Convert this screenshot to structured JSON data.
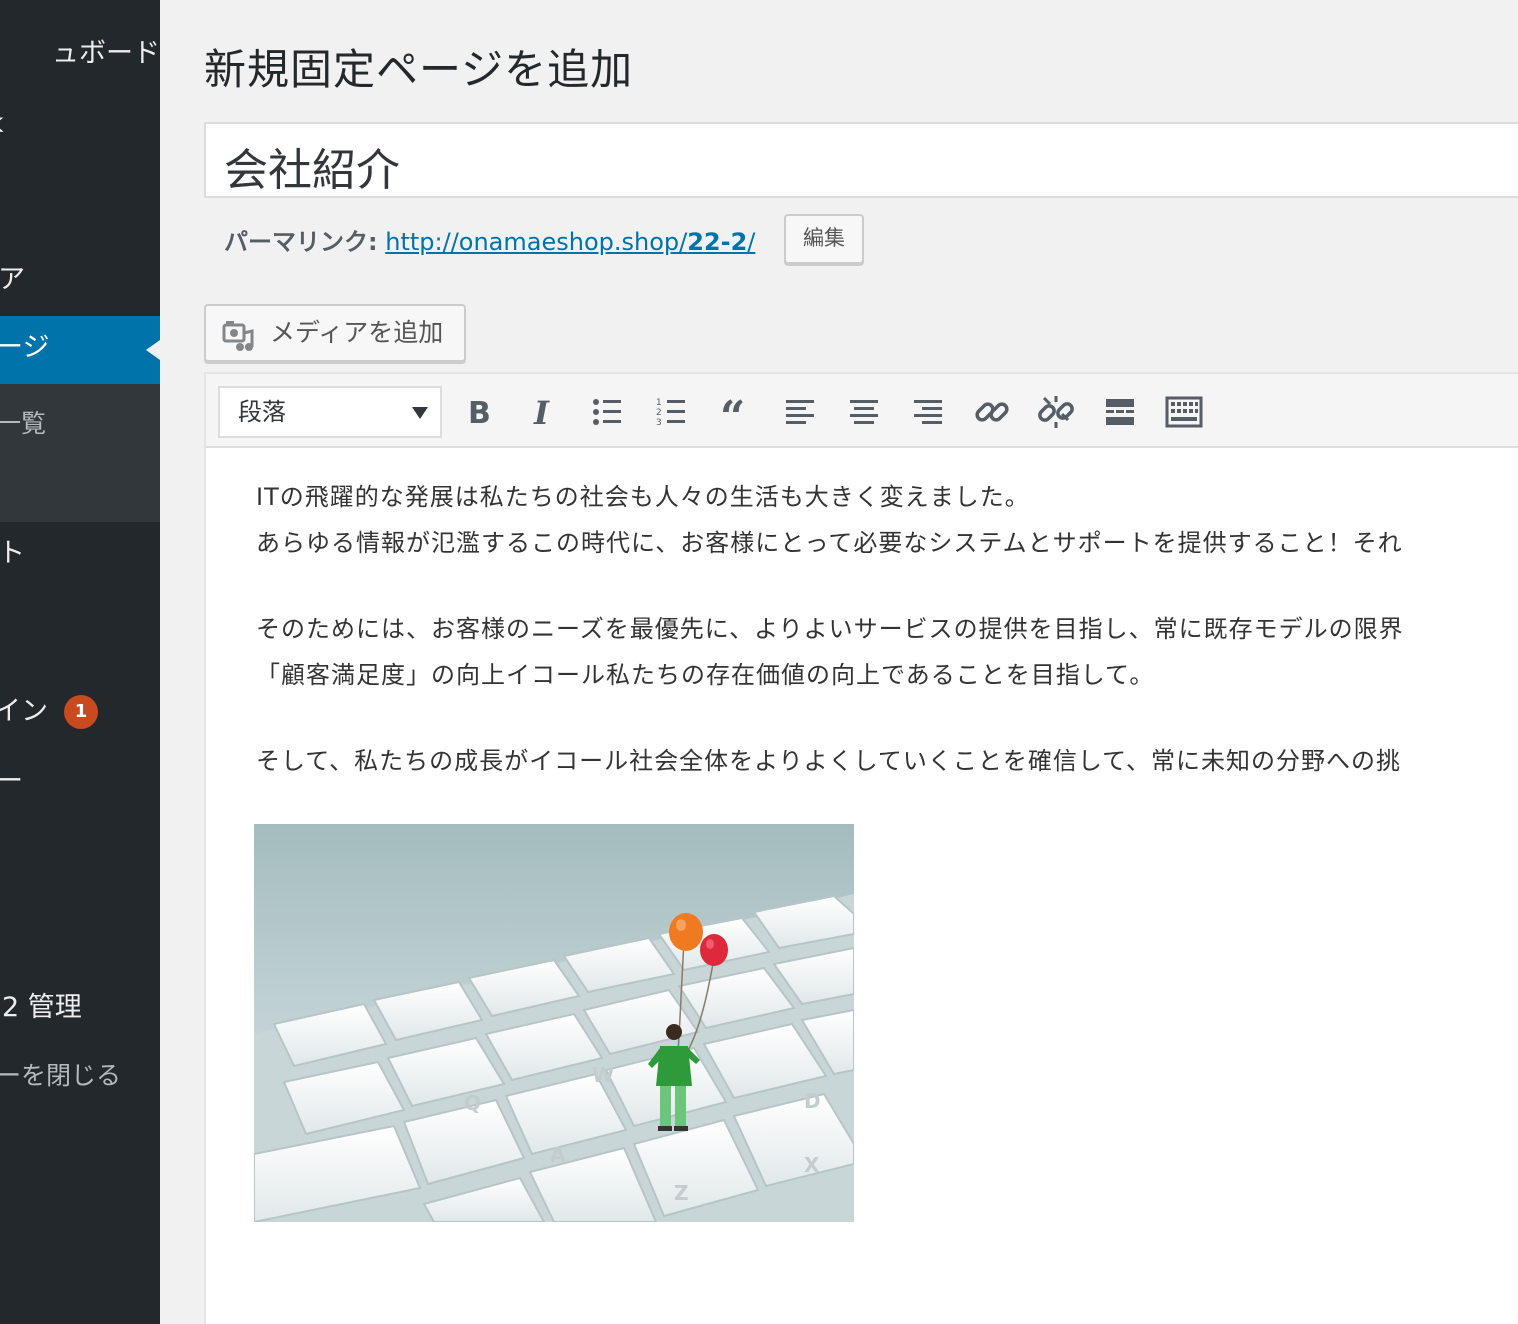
{
  "sidebar": {
    "dashboard": "ュボード",
    "jetpack": "k",
    "media": "ア",
    "pages": "ージ",
    "pages_all": "一覧",
    "comments": "ト",
    "plugins": "イン",
    "plugins_badge": "1",
    "users": "ー",
    "wp2": "2 管理",
    "collapse": "ーを閉じる"
  },
  "page": {
    "title": "新規固定ページを追加"
  },
  "post": {
    "title": "会社紹介",
    "permalink_label": "パーマリンク:",
    "permalink_base": "http://onamaeshop.shop/",
    "permalink_slug": "22-2",
    "permalink_trailing": "/",
    "edit_slug_label": "編集"
  },
  "media": {
    "add_media_label": "メディアを追加"
  },
  "toolbar": {
    "format_selected": "段落",
    "buttons": [
      "bold-icon",
      "italic-icon",
      "bulleted-list-icon",
      "numbered-list-icon",
      "blockquote-icon",
      "align-left-icon",
      "align-center-icon",
      "align-right-icon",
      "insert-link-icon",
      "remove-link-icon",
      "read-more-icon",
      "toolbar-toggle-icon"
    ]
  },
  "content": {
    "p1_line1": "ITの飛躍的な発展は私たちの社会も人々の生活も大きく変えました。",
    "p1_line2": "あらゆる情報が氾濫するこの時代に、お客様にとって必要なシステムとサポートを提供すること！それ",
    "p2_line1": "そのためには、お客様のニーズを最優先に、よりよいサービスの提供を目指し、常に既存モデルの限界",
    "p2_line2": "「顧客満足度」の向上イコール私たちの存在価値の向上であることを目指して。",
    "p3_line1": "そして、私たちの成長がイコール社会全体をよりよくしていくことを確信して、常に未知の分野への挑"
  },
  "image_keys": {
    "k1": "Q",
    "k2": "W",
    "k3": "A",
    "k4": "Z",
    "k5": "X",
    "k6": "D"
  },
  "colors": {
    "sidebar_bg": "#23282d",
    "active_blue": "#0073aa",
    "badge_orange": "#ca4a1f",
    "link_blue": "#0073aa"
  }
}
